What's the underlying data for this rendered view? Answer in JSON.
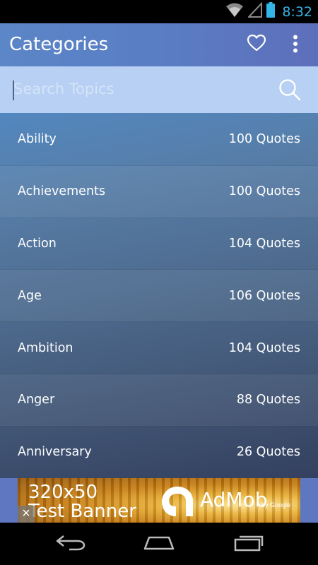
{
  "status_bar": {
    "time": "8:32",
    "icons": [
      "wifi-icon",
      "signal-icon",
      "battery-icon"
    ],
    "accent_color": "#33b5e5"
  },
  "action_bar": {
    "title": "Categories",
    "icons": [
      "heart-icon",
      "overflow-menu-icon"
    ],
    "colors": {
      "start": "#5b86c8",
      "end": "#5e6fba"
    }
  },
  "search": {
    "placeholder": "Search Topics",
    "value": "",
    "icon": "search-icon",
    "background": "#b7d0f3"
  },
  "categories": [
    {
      "name": "Ability",
      "count": "100 Quotes"
    },
    {
      "name": "Achievements",
      "count": "100 Quotes"
    },
    {
      "name": "Action",
      "count": "104 Quotes"
    },
    {
      "name": "Age",
      "count": "106 Quotes"
    },
    {
      "name": "Ambition",
      "count": "104 Quotes"
    },
    {
      "name": "Anger",
      "count": "88 Quotes"
    },
    {
      "name": "Anniversary",
      "count": "26 Quotes"
    }
  ],
  "ad": {
    "line1": "320x50",
    "line2": "Test Banner",
    "brand": "AdMob",
    "by": "by Google",
    "close": "×"
  },
  "nav_bar": {
    "icons": [
      "back-icon",
      "home-icon",
      "recent-apps-icon"
    ]
  }
}
